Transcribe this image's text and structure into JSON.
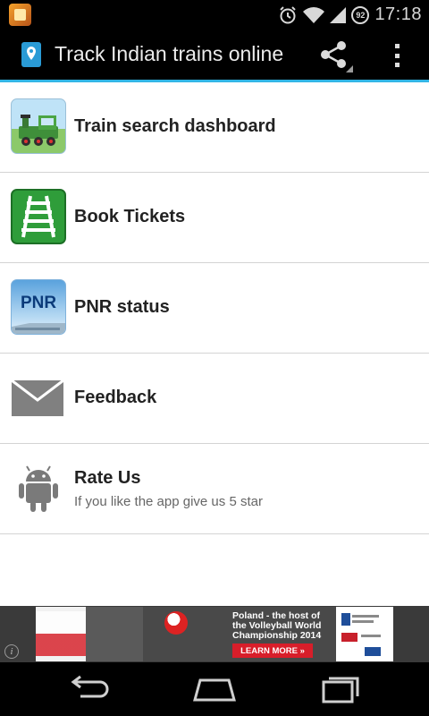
{
  "status_bar": {
    "time": "17:18",
    "battery_level": "92",
    "icons": [
      "app-notification-icon",
      "alarm-icon",
      "wifi-icon",
      "signal-icon",
      "battery-icon"
    ]
  },
  "action_bar": {
    "title": "Track Indian trains online",
    "icons": [
      "location-pin-icon",
      "share-icon",
      "overflow-menu-icon"
    ]
  },
  "menu": {
    "items": [
      {
        "label": "Train search dashboard",
        "icon": "train-icon"
      },
      {
        "label": "Book Tickets",
        "icon": "railway-track-icon"
      },
      {
        "label": "PNR status",
        "icon": "pnr-icon",
        "icon_text": "PNR"
      },
      {
        "label": "Feedback",
        "icon": "mail-icon"
      },
      {
        "label": "Rate Us",
        "subtitle": "If you like the app give us 5 star",
        "icon": "android-icon"
      }
    ]
  },
  "ad": {
    "headline": "Poland - the host of the Volleyball World Championship 2014",
    "cta": "LEARN MORE »",
    "info_symbol": "i"
  },
  "nav_bar": {
    "buttons": [
      "back-icon",
      "home-icon",
      "recents-icon"
    ]
  },
  "colors": {
    "accent": "#33b5e5",
    "bar_background": "#000000",
    "ad_cta": "#d81e2a"
  }
}
